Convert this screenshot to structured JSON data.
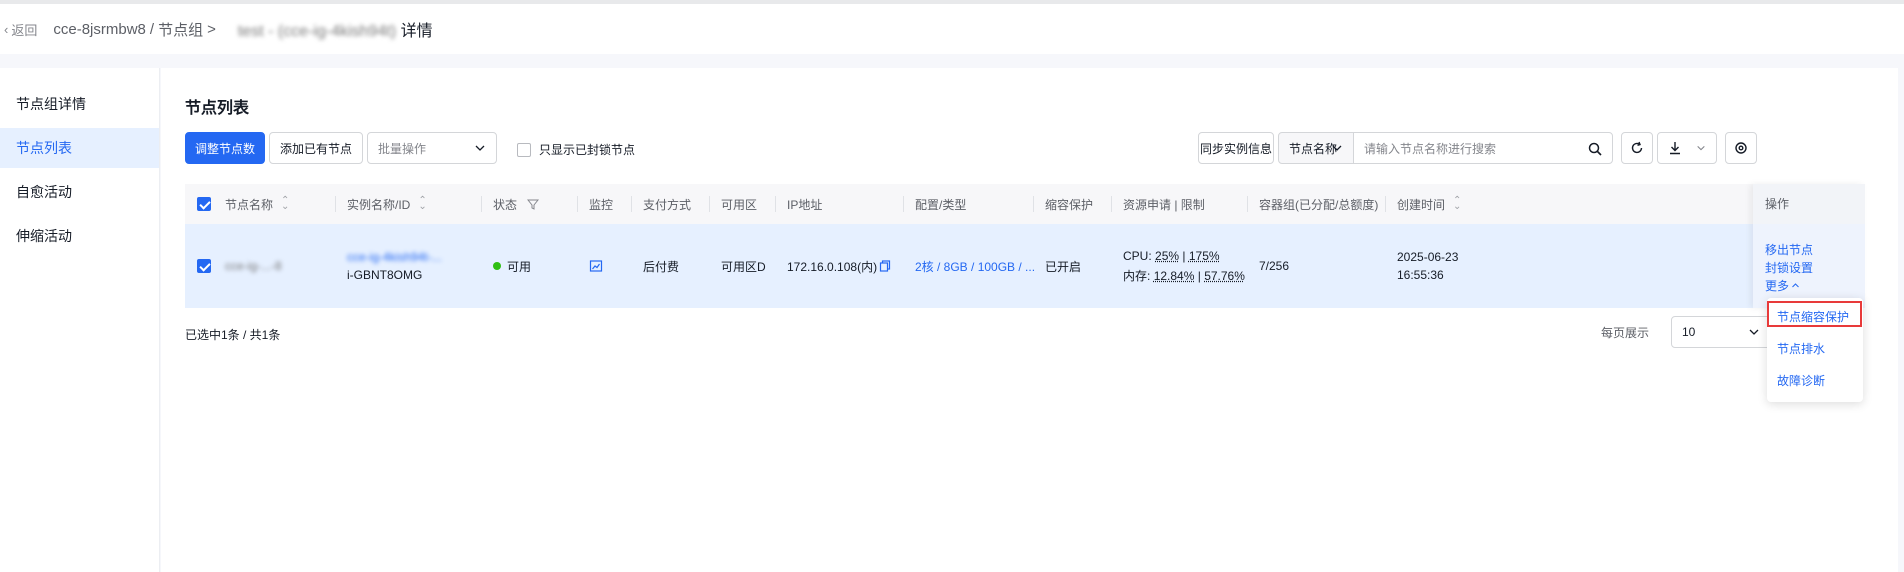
{
  "header": {
    "back_label": "返回",
    "cluster": "cce-8jsrmbw8",
    "crumb_sep": "/",
    "node_group": "节点组",
    "arrow": ">",
    "group_name": "test - (cce-ig-4kish94t)",
    "detail_label": "详情"
  },
  "sidebar": {
    "items": [
      {
        "label": "节点组详情"
      },
      {
        "label": "节点列表"
      },
      {
        "label": "自愈活动"
      },
      {
        "label": "伸缩活动"
      }
    ]
  },
  "main": {
    "title": "节点列表",
    "toolbar": {
      "adjust_label": "调整节点数",
      "add_label": "添加已有节点",
      "batch_placeholder": "批量操作",
      "only_locked_label": "只显示已封锁节点",
      "sync_label": "同步实例信息",
      "search_field": "节点名称",
      "search_placeholder": "请输入节点名称进行搜索"
    },
    "table": {
      "headers": [
        "节点名称",
        "实例名称/ID",
        "状态",
        "监控",
        "支付方式",
        "可用区",
        "IP地址",
        "配置/类型",
        "缩容保护",
        "资源申请 | 限制",
        "容器组(已分配/总额度)",
        "创建时间",
        "操作"
      ],
      "row": {
        "node_name": "cce-ig-...-8",
        "instance_name": "cce-ig-4kish94t-...",
        "instance_id": "i-GBNT8OMG",
        "status": "可用",
        "payment": "后付费",
        "zone": "可用区D",
        "ip": "172.16.0.108(内)",
        "config": "2核 / 8GB / 100GB / ...",
        "scale_protect": "已开启",
        "cpu_label": "CPU:",
        "cpu_req": "25%",
        "cpu_sep": " | ",
        "cpu_limit": "175%",
        "mem_label": "内存:",
        "mem_req": "12.84%",
        "mem_sep": " | ",
        "mem_limit": "57.76%",
        "pods": "7/256",
        "created_date": "2025-06-23",
        "created_time": "16:55:36",
        "ops": [
          "移出节点",
          "封锁设置",
          "更多"
        ]
      }
    },
    "footer": {
      "selected_info": "已选中1条 / 共1条",
      "per_page_label": "每页展示",
      "per_page_value": "10"
    },
    "more_menu": {
      "items": [
        "节点缩容保护",
        "节点排水",
        "故障诊断"
      ]
    }
  },
  "colors": {
    "primary": "#2468f2",
    "selected_row": "#e6f0ff",
    "status_ok": "#30bf13",
    "highlight": "#e83a3a"
  }
}
